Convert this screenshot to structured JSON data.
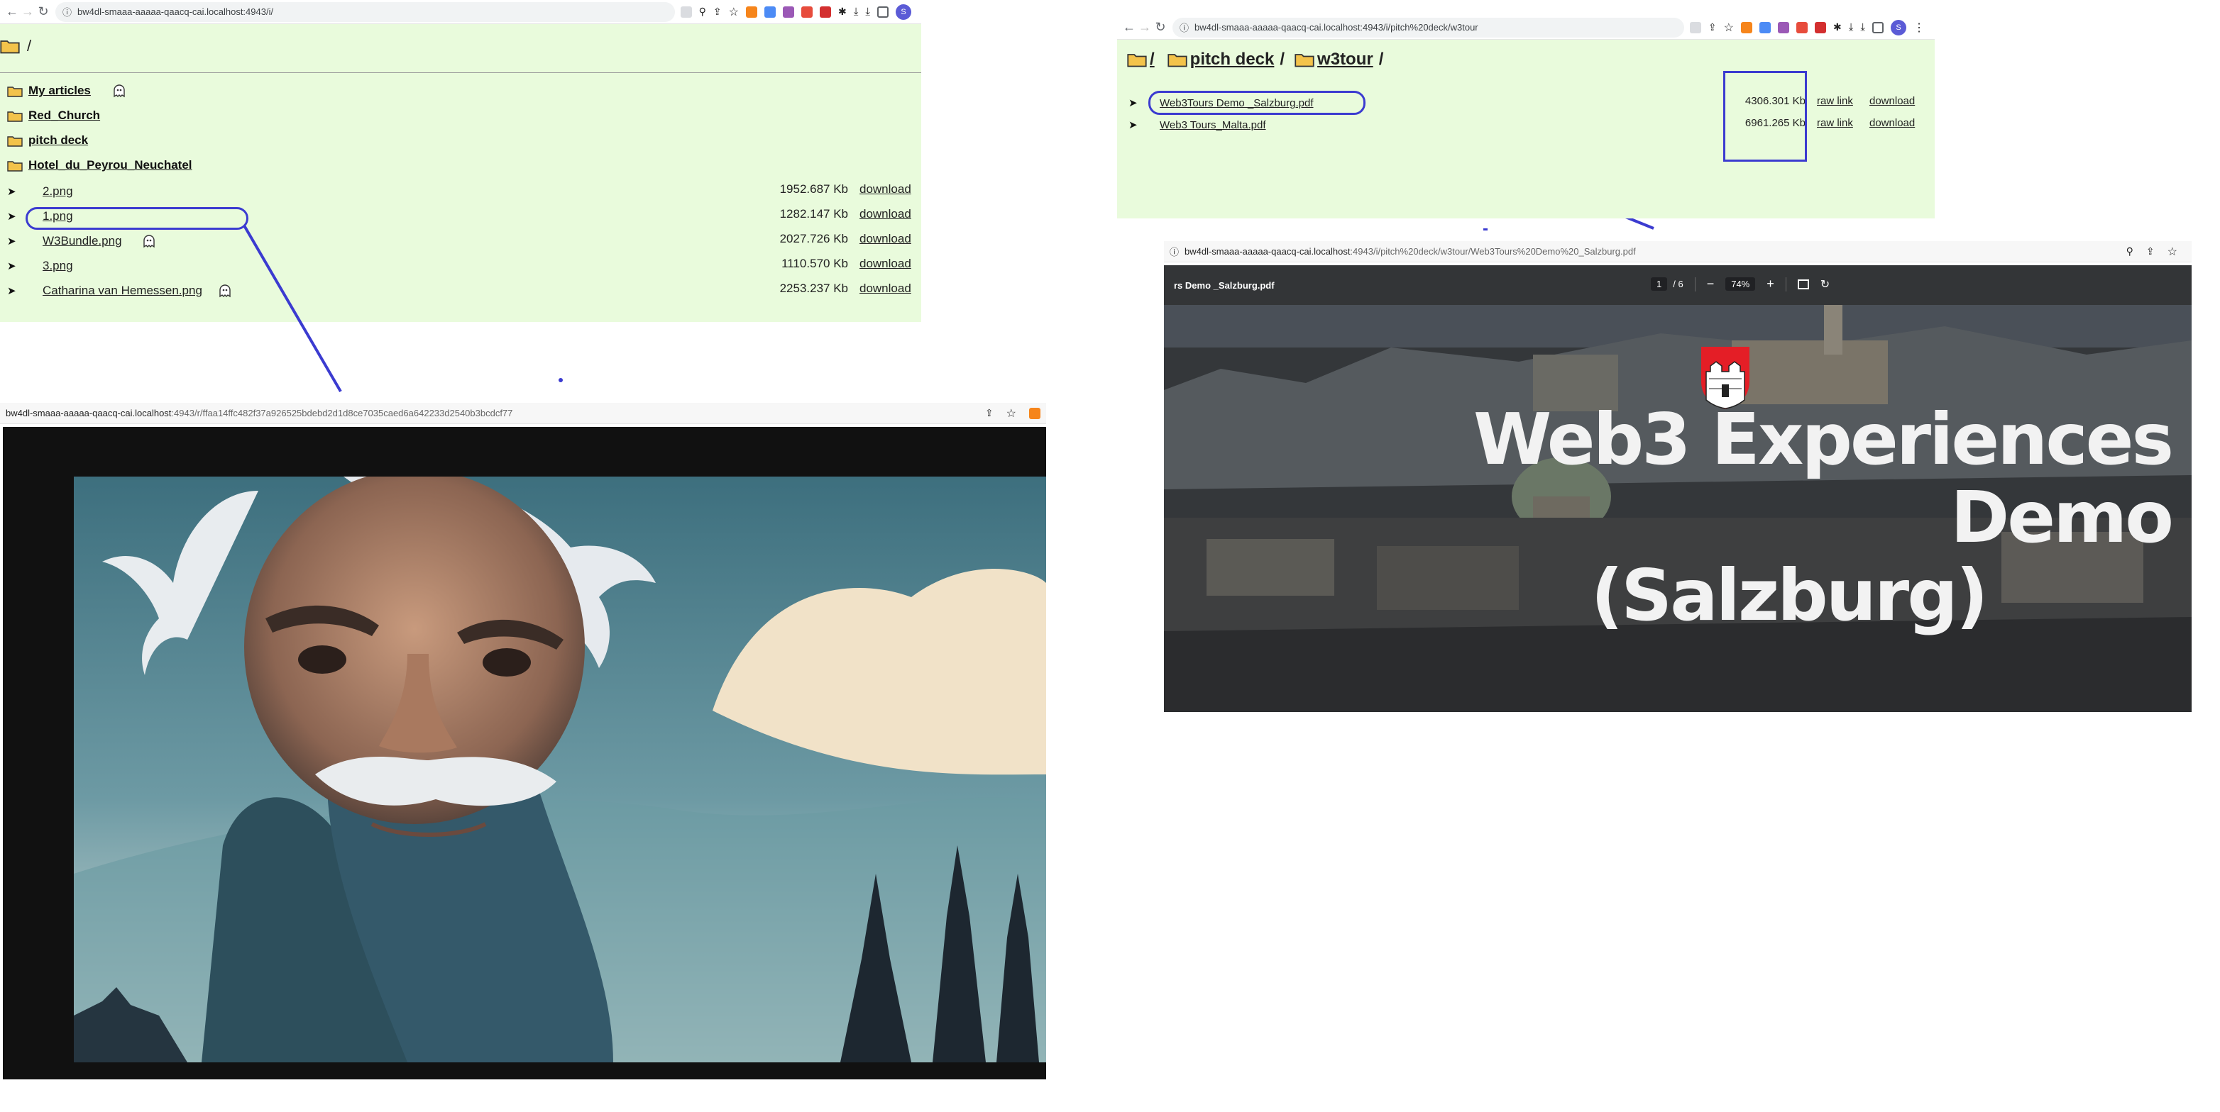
{
  "window1": {
    "url": "bw4dl-smaaa-aaaaa-qaacq-cai.localhost:4943/i/",
    "breadcrumb": "/",
    "folders": [
      {
        "name": "My articles",
        "has_badge": true
      },
      {
        "name": "Red_Church",
        "has_badge": false
      },
      {
        "name": "pitch deck",
        "has_badge": false
      },
      {
        "name": "Hotel_du_Peyrou_Neuchatel",
        "has_badge": false
      }
    ],
    "files": [
      {
        "name": "2.png",
        "size": "1952.687 Kb",
        "action": "download",
        "has_badge": false
      },
      {
        "name": "1.png",
        "size": "1282.147 Kb",
        "action": "download",
        "has_badge": false
      },
      {
        "name": "W3Bundle.png",
        "size": "2027.726 Kb",
        "action": "download",
        "has_badge": true
      },
      {
        "name": "3.png",
        "size": "1110.570 Kb",
        "action": "download",
        "has_badge": false
      },
      {
        "name": "Catharina van Hemessen.png",
        "size": "2253.237 Kb",
        "action": "download",
        "has_badge": true
      }
    ]
  },
  "window2": {
    "url_host": "bw4dl-smaaa-aaaaa-qaacq-cai.localhost",
    "url_path": ":4943/r/ffaa14ffc482f37a926525bdebd2d1d8ce7035caed6a642233d2540b3bcdcf77",
    "image_icon": "portrait-image"
  },
  "window3": {
    "url": "bw4dl-smaaa-aaaaa-qaacq-cai.localhost:4943/i/pitch%20deck/w3tour",
    "breadcrumb": [
      {
        "label": "/"
      },
      {
        "label": "pitch deck"
      },
      {
        "label": "w3tour"
      }
    ],
    "separator": "/",
    "files": [
      {
        "name": "Web3Tours Demo _Salzburg.pdf",
        "size": "4306.301 Kb",
        "raw": "raw link",
        "action": "download"
      },
      {
        "name": "Web3 Tours_Malta.pdf",
        "size": "6961.265 Kb",
        "raw": "raw link",
        "action": "download"
      }
    ]
  },
  "window4": {
    "url_host": "bw4dl-smaaa-aaaaa-qaacq-cai.localhost",
    "url_path": ":4943/i/pitch%20deck/w3tour/Web3Tours%20Demo%20_Salzburg.pdf",
    "doc_title": "rs Demo _Salzburg.pdf",
    "page_current": "1",
    "page_total": "/ 6",
    "zoom": "74%",
    "slide_title_line1": "Web3 Experiences Demo",
    "slide_title_line2": "(Salzburg)"
  },
  "colors": {
    "listing_bg": "#e9fbdc",
    "callout": "#3b3bd0",
    "pdf_toolbar": "#333537"
  },
  "icons": {
    "back": "back-arrow-icon",
    "forward": "forward-arrow-icon",
    "reload": "reload-icon",
    "info": "site-info-icon",
    "folder": "folder-icon",
    "badge": "ghost-badge-icon",
    "arrow": "expand-arrow-icon"
  },
  "glyphs": {
    "back": "←",
    "forward": "→",
    "reload": "↻",
    "info": "ⓘ",
    "star": "☆",
    "share": "⇪",
    "download": "⤓",
    "zoom": "⚲",
    "puzzle": "✱",
    "menu": "⋮",
    "minus": "−",
    "plus": "+",
    "triangle": "➤",
    "avatar": "S"
  }
}
